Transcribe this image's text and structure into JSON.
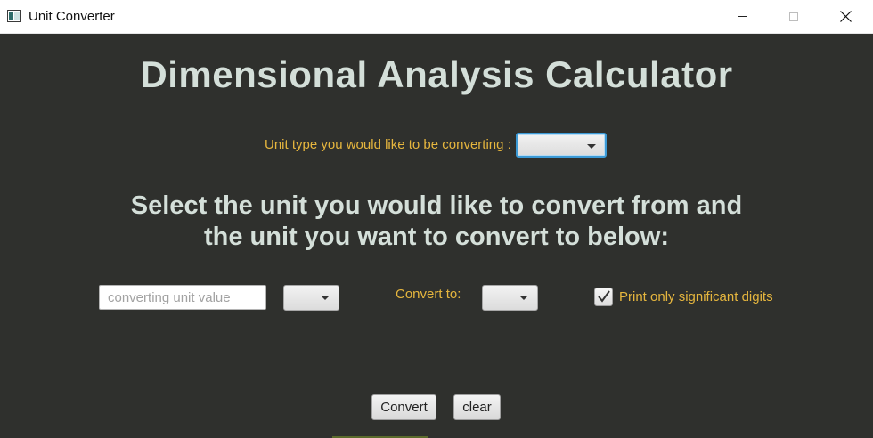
{
  "window": {
    "title": "Unit Converter",
    "app_icon": "app-window-icon",
    "controls": [
      "minimize-icon",
      "maximize-icon",
      "close-icon"
    ]
  },
  "main": {
    "title": "Dimensional Analysis Calculator",
    "unit_type_label": "Unit type you would like to be converting :",
    "unit_type_selected": "",
    "instructions_line1": "Select the unit you would like to convert from and",
    "instructions_line2": "the unit you want to convert to below:",
    "value_input": {
      "value": "",
      "placeholder": "converting unit value"
    },
    "from_unit_selected": "",
    "convert_to_label": "Convert to:",
    "to_unit_selected": "",
    "sig_digits_label": "Print only significant digits",
    "sig_digits_checked": true,
    "convert_button": "Convert",
    "clear_button": "clear"
  },
  "colors": {
    "background": "#2f302d",
    "title_text": "#d4dfd9",
    "label_text": "#e6b63e",
    "focus_border": "#3c9ad6"
  }
}
